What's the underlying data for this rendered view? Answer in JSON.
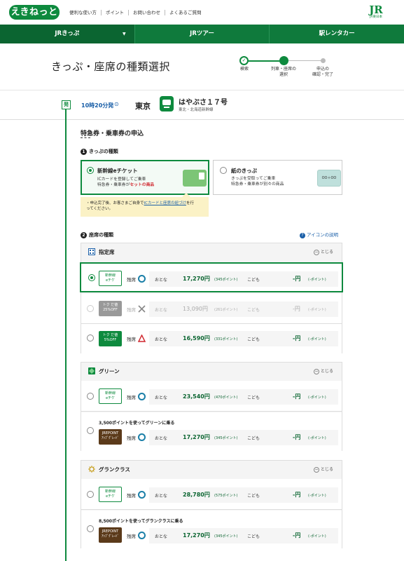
{
  "header": {
    "logo": "えきねっと",
    "links": [
      "便利な使い方",
      "ポイント",
      "お問い合わせ",
      "よくあるご質問"
    ],
    "jr_mark": "JR",
    "jr_sub": "JR東日本"
  },
  "nav": {
    "items": [
      "JRきっぷ",
      "JRツアー",
      "駅レンタカー"
    ],
    "caret": "▼"
  },
  "page": {
    "title": "きっぷ・座席の種類選択",
    "steps": [
      "検索",
      "列車・座席の\n選択",
      "申込の\n確認・完了"
    ]
  },
  "train": {
    "badge": "発",
    "time": "10時20分発",
    "time_icon": "⊙",
    "station": "東京",
    "name": "はやぶさ１７号",
    "line": "東北・北海道新幹線"
  },
  "section": {
    "title": "特急券・乗車券の申込",
    "ticket_type_head": "きっぷの種類",
    "ticket_type_num": "1",
    "seat_type_head": "座席の種類",
    "seat_type_num": "2",
    "icon_help": "アイコンの説明",
    "icon_help_q": "?"
  },
  "ticket_types": {
    "eticket": {
      "title": "新幹線eチケット",
      "desc1": "ICカードを登録してご乗車",
      "desc2_a": "特急券・乗車券が",
      "desc2_b": "セットの商品",
      "card_text": "Suica"
    },
    "paper": {
      "title": "紙のきっぷ",
      "desc1": "きっぷを受取ってご乗車",
      "desc2": "特急券・乗車券が別々の商品",
      "card_text": "OO＋OO"
    }
  },
  "notice": {
    "line1_a": "・申込完了後、お客さまご自身で",
    "line1_link": "ICカードと座席の紐づけ",
    "line1_b": "を行",
    "line2": "ってください。"
  },
  "labels": {
    "zan": "残席",
    "adult": "おとな",
    "child": "こども",
    "collapse": "とじる",
    "minus": "−",
    "child_price": "-円",
    "child_pts": "(-ポイント)"
  },
  "groups": [
    {
      "title": "指定席",
      "icon": "reserved-seat-icon",
      "rows": [
        {
          "badge": "新幹線\neチケ",
          "badge_style": "eticket",
          "avail": "circle",
          "adult_price": "17,270円",
          "adult_pts": "(345ポイント)",
          "selected": true,
          "dim": false
        },
        {
          "badge": "トク だ値\n25%OFF",
          "badge_style": "gray",
          "avail": "cross",
          "adult_price": "13,090円",
          "adult_pts": "(261ポイント)",
          "selected": false,
          "dim": true
        },
        {
          "badge": "トク だ値\n5%OFF",
          "badge_style": "green",
          "avail": "triangle",
          "adult_price": "16,590円",
          "adult_pts": "(331ポイント)",
          "selected": false,
          "dim": false
        }
      ]
    },
    {
      "title": "グリーン",
      "icon": "green-car-icon",
      "rows": [
        {
          "badge": "新幹線\neチケ",
          "badge_style": "eticket",
          "avail": "circle",
          "adult_price": "23,540円",
          "adult_pts": "(470ポイント)",
          "selected": false,
          "dim": false
        },
        {
          "point_head": "3,500ポイントを使ってグリーンに乗る",
          "badge": "JREPOINT\nｱｯﾌﾟｸﾞﾚｰﾄﾞ",
          "badge_style": "brown",
          "avail": "circle",
          "adult_price": "17,270円",
          "adult_pts": "(345ポイント)",
          "selected": false,
          "dim": false
        }
      ]
    },
    {
      "title": "グランクラス",
      "icon": "gran-class-icon",
      "rows": [
        {
          "badge": "新幹線\neチケ",
          "badge_style": "eticket",
          "avail": "circle",
          "adult_price": "28,780円",
          "adult_pts": "(575ポイント)",
          "selected": false,
          "dim": false
        },
        {
          "point_head": "8,500ポイントを使ってグランクラスに乗る",
          "badge": "JREPOINT\nｱｯﾌﾟｸﾞﾚｰﾄﾞ",
          "badge_style": "brown",
          "avail": "circle",
          "adult_price": "17,270円",
          "adult_pts": "(345ポイント)",
          "selected": false,
          "dim": false
        }
      ]
    }
  ],
  "colors": {
    "brand_green": "#0e8a3e",
    "price_green": "#0b6531",
    "link_blue": "#1a5fa8",
    "notice_yellow": "#fbf2c6"
  }
}
